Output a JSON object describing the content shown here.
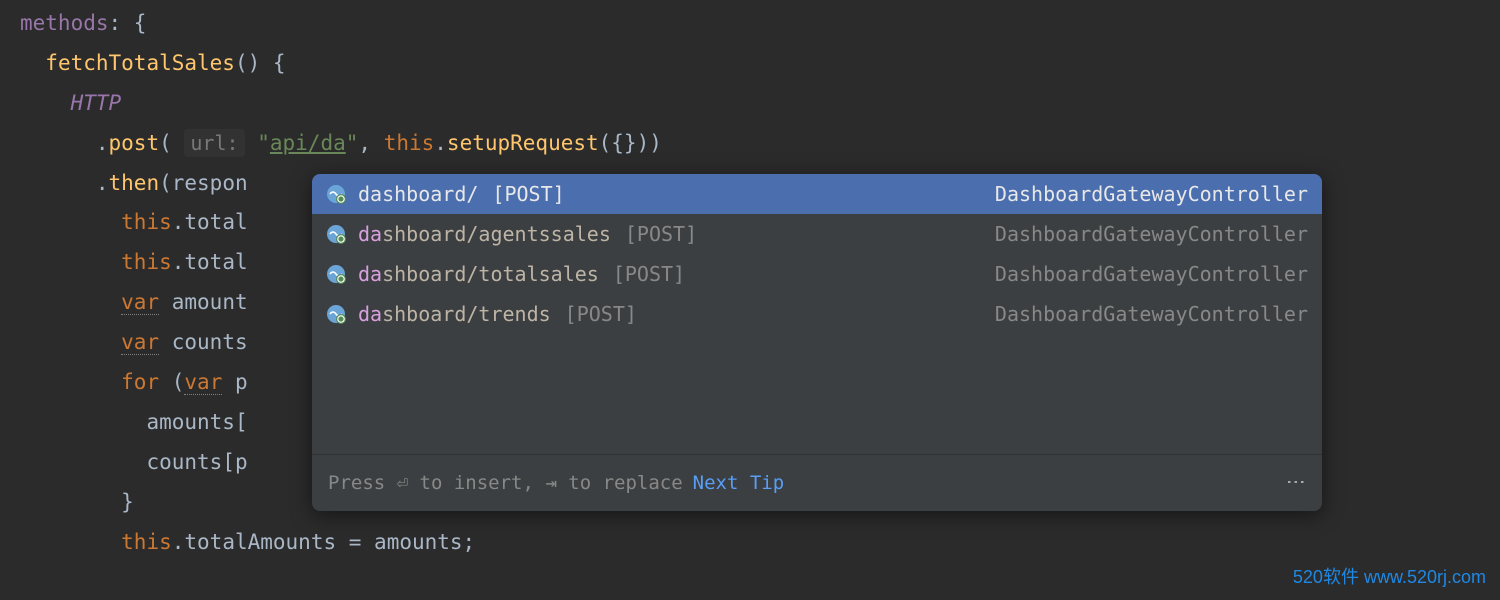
{
  "code": {
    "methods_label": "methods",
    "colon_brace": ": {",
    "func_name": "fetchTotalSales",
    "func_parens": "() {",
    "http_ident": "HTTP",
    "post_method": "post",
    "url_hint": "url:",
    "url_prefix": "\"",
    "url_value": "api/da",
    "url_suffix": "\"",
    "comma": ", ",
    "this_kw": "this",
    "setup_method": "setupRequest",
    "setup_args": "({}))",
    "then_method": "then",
    "then_arg": "respon",
    "line_total1_prefix": "this",
    "line_total1_prop": "total",
    "line_total2_prefix": "this",
    "line_total2_prop": "total",
    "var_kw": "var",
    "amount_ident": "amount",
    "counts_ident": "counts",
    "for_kw": "for",
    "for_paren": "(",
    "for_var": "var",
    "for_p": "p",
    "amounts_br": "amounts[",
    "counts_br": "counts[p",
    "close_brace": "}",
    "final_line_this": "this",
    "final_line_prop": "totalAmounts",
    "final_line_eq": " = ",
    "final_line_rhs": "amounts;"
  },
  "popup": {
    "items": [
      {
        "match": "da",
        "rest": "shboard/",
        "meta": "[POST]",
        "right": "DashboardGatewayController",
        "selected": true
      },
      {
        "match": "da",
        "rest": "shboard/agentssales",
        "meta": "[POST]",
        "right": "DashboardGatewayController",
        "selected": false
      },
      {
        "match": "da",
        "rest": "shboard/totalsales",
        "meta": "[POST]",
        "right": "DashboardGatewayController",
        "selected": false
      },
      {
        "match": "da",
        "rest": "shboard/trends",
        "meta": "[POST]",
        "right": "DashboardGatewayController",
        "selected": false
      }
    ],
    "footer_hint_1": "Press ",
    "footer_key_1": "⏎",
    "footer_hint_2": " to insert, ",
    "footer_key_2": "⇥",
    "footer_hint_3": " to replace",
    "footer_link": "Next Tip",
    "more_glyph": "⋮"
  },
  "watermark": {
    "text1": "520软件 ",
    "text2": "www.520rj.com"
  }
}
